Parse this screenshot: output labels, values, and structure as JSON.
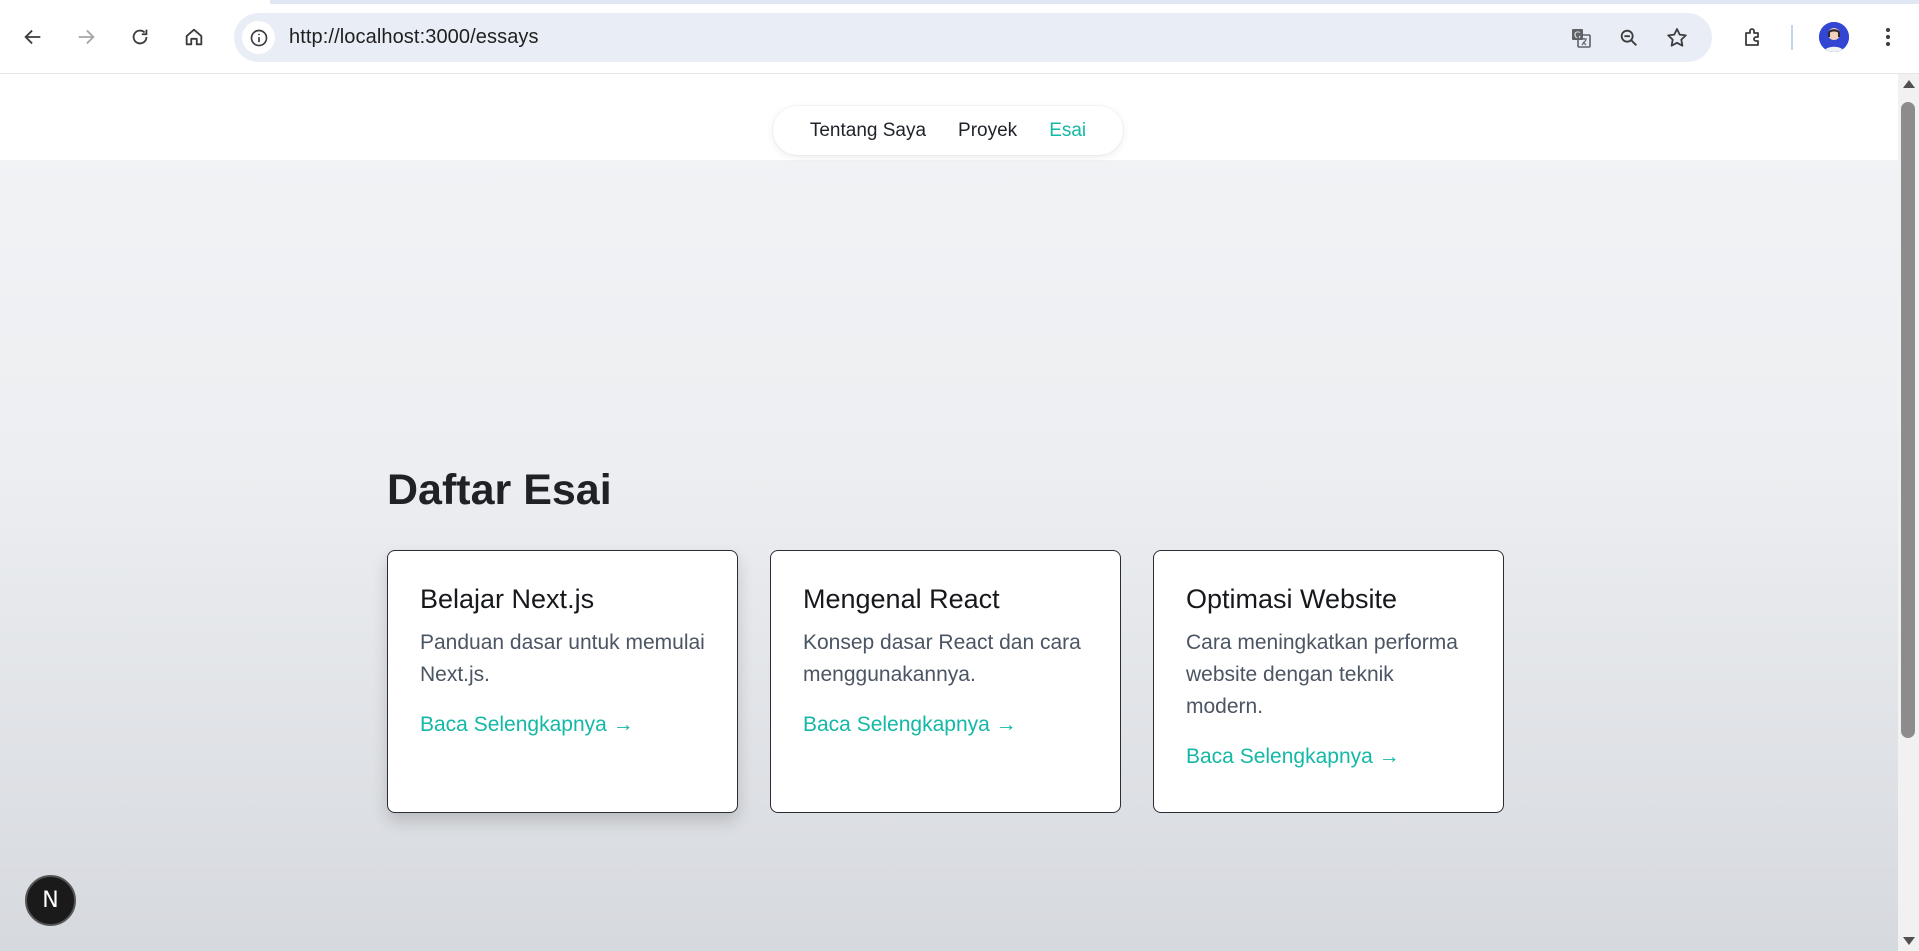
{
  "browser": {
    "url": "http://localhost:3000/essays",
    "icons": [
      "back-icon",
      "forward-icon",
      "reload-icon",
      "home-icon",
      "info-icon",
      "translate-icon",
      "zoom-icon",
      "bookmark-star-icon",
      "extensions-icon",
      "avatar",
      "menu-icon"
    ]
  },
  "site_nav": {
    "items": [
      {
        "label": "Tentang Saya"
      },
      {
        "label": "Proyek"
      },
      {
        "label": "Esai",
        "active": true
      }
    ],
    "accent_color": "#14b8a6"
  },
  "main": {
    "title": "Daftar Esai",
    "essays": [
      {
        "title": "Belajar Next.js",
        "description": "Panduan dasar untuk memulai Next.js.",
        "link": "Baca Selengkapnya →"
      },
      {
        "title": "Mengenal React",
        "description": "Konsep dasar React dan cara menggunakannya.",
        "link": "Baca Selengkapnya →"
      },
      {
        "title": "Optimasi Website",
        "description": "Cara meningkatkan performa website dengan teknik modern.",
        "link": "Baca Selengkapnya →"
      }
    ]
  },
  "dev_badge": {
    "label": "N"
  }
}
